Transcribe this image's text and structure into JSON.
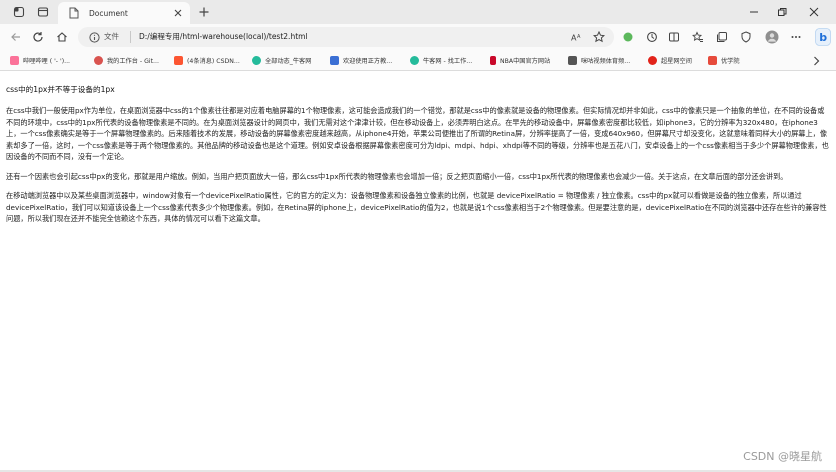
{
  "tab": {
    "title": "Document"
  },
  "address": {
    "file_label": "文件",
    "url": "D:/编程专用/html-warehouse(local)/test2.html"
  },
  "bookmarks": [
    {
      "label": "哔哩哔哩 ( '- ')...",
      "color": "#fb7299",
      "icon": "bilibili-icon"
    },
    {
      "label": "我的工作台 - Git...",
      "color": "#d9534f",
      "icon": "gitee-icon"
    },
    {
      "label": "(4条消息) CSDN...",
      "color": "#fc5531",
      "icon": "csdn-icon"
    },
    {
      "label": "全部动态_牛客网",
      "color": "#25bb9b",
      "icon": "nowcoder-icon"
    },
    {
      "label": "欢迎使用正方教...",
      "color": "#3b6fd4",
      "icon": "zf-icon"
    },
    {
      "label": "牛客网 - 找工作...",
      "color": "#25bb9b",
      "icon": "nowcoder-icon"
    },
    {
      "label": "NBA中国官方网站",
      "color": "#c9082a",
      "icon": "nba-icon"
    },
    {
      "label": "咪咕视频体育频...",
      "color": "#555555",
      "icon": "migu-icon"
    },
    {
      "label": "超星网空间",
      "color": "#e2231a",
      "icon": "chaoxing-icon"
    },
    {
      "label": "优学院",
      "color": "#e64a3b",
      "icon": "ulearning-icon"
    }
  ],
  "content": {
    "heading": "css中的1px并不等于设备的1px",
    "paragraphs": [
      "在css中我们一般使用px作为单位，在桌面浏览器中css的1个像素往往都是对应着电脑屏幕的1个物理像素，这可能会造成我们的一个错觉，那就是css中的像素就是设备的物理像素。但实际情况却并非如此，css中的像素只是一个抽象的单位，在不同的设备或不同的环境中，css中的1px所代表的设备物理像素是不同的。在为桌面浏览器设计的网页中，我们无需对这个津津计较，但在移动设备上，必须弄明白这点。在早先的移动设备中，屏幕像素密度都比较低，如iphone3，它的分辨率为320x480，在iphone3上，一个css像素确实是等于一个屏幕物理像素的。后来随着技术的发展，移动设备的屏幕像素密度越来越高，从iphone4开始，苹果公司便推出了所谓的Retina屏，分辨率提高了一倍，变成640x960，但屏幕尺寸却没变化，这就意味着同样大小的屏幕上，像素却多了一倍，这时，一个css像素是等于两个物理像素的。其他品牌的移动设备也是这个道理。例如安卓设备根据屏幕像素密度可分为ldpi、mdpi、hdpi、xhdpi等不同的等级，分辨率也是五花八门，安卓设备上的一个css像素相当于多少个屏幕物理像素，也因设备的不同而不同，没有一个定论。",
      "还有一个因素也会引起css中px的变化，那就是用户缩放。例如，当用户把页面放大一倍，那么css中1px所代表的物理像素也会增加一倍；反之把页面缩小一倍，css中1px所代表的物理像素也会减少一倍。关于这点，在文章后面的部分还会讲到。",
      "在移动端浏览器中以及某些桌面浏览器中，window对象有一个devicePixelRatio属性，它的官方的定义为：设备物理像素和设备独立像素的比例，也就是 devicePixelRatio = 物理像素 / 独立像素。css中的px就可以看做是设备的独立像素，所以通过devicePixelRatio，我们可以知道该设备上一个css像素代表多少个物理像素。例如，在Retina屏的iphone上，devicePixelRatio的值为2，也就是说1个css像素相当于2个物理像素。但是要注意的是，devicePixelRatio在不同的浏览器中还存在些许的兼容性问题，所以我们现在还并不能完全信赖这个东西，具体的情况可以看下这篇文章。"
    ]
  },
  "watermark": "CSDN @晓星航"
}
